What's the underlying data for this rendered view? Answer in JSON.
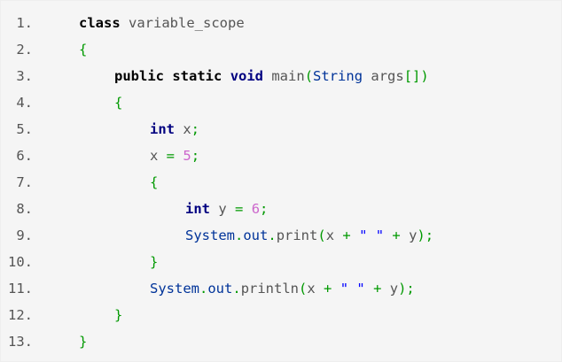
{
  "code": {
    "lines": [
      {
        "number": "1.",
        "tokens": [
          {
            "text": "class",
            "type": "kw"
          },
          {
            "text": " variable_scope",
            "type": "ident"
          }
        ],
        "indent": 0
      },
      {
        "number": "2.",
        "tokens": [
          {
            "text": "{",
            "type": "punc"
          }
        ],
        "indent": 0
      },
      {
        "number": "3.",
        "tokens": [
          {
            "text": "public",
            "type": "kw"
          },
          {
            "text": " ",
            "type": "ident"
          },
          {
            "text": "static",
            "type": "kw"
          },
          {
            "text": " ",
            "type": "ident"
          },
          {
            "text": "void",
            "type": "kw-type"
          },
          {
            "text": " main",
            "type": "ident"
          },
          {
            "text": "(",
            "type": "punc"
          },
          {
            "text": "String",
            "type": "cls"
          },
          {
            "text": " args",
            "type": "ident"
          },
          {
            "text": "[])",
            "type": "punc"
          }
        ],
        "indent": 1
      },
      {
        "number": "4.",
        "tokens": [
          {
            "text": "{",
            "type": "punc"
          }
        ],
        "indent": 1
      },
      {
        "number": "5.",
        "tokens": [
          {
            "text": "int",
            "type": "kw-type"
          },
          {
            "text": " x",
            "type": "ident"
          },
          {
            "text": ";",
            "type": "punc"
          }
        ],
        "indent": 2
      },
      {
        "number": "6.",
        "tokens": [
          {
            "text": "x ",
            "type": "ident"
          },
          {
            "text": "=",
            "type": "punc"
          },
          {
            "text": " ",
            "type": "ident"
          },
          {
            "text": "5",
            "type": "num"
          },
          {
            "text": ";",
            "type": "punc"
          }
        ],
        "indent": 2
      },
      {
        "number": "7.",
        "tokens": [
          {
            "text": "{",
            "type": "punc"
          }
        ],
        "indent": 2
      },
      {
        "number": "8.",
        "tokens": [
          {
            "text": "int",
            "type": "kw-type"
          },
          {
            "text": " y ",
            "type": "ident"
          },
          {
            "text": "=",
            "type": "punc"
          },
          {
            "text": " ",
            "type": "ident"
          },
          {
            "text": "6",
            "type": "num"
          },
          {
            "text": ";",
            "type": "punc"
          }
        ],
        "indent": 3
      },
      {
        "number": "9.",
        "tokens": [
          {
            "text": "System",
            "type": "cls"
          },
          {
            "text": ".",
            "type": "punc"
          },
          {
            "text": "out",
            "type": "cls"
          },
          {
            "text": ".",
            "type": "punc"
          },
          {
            "text": "print",
            "type": "ident"
          },
          {
            "text": "(",
            "type": "punc"
          },
          {
            "text": "x ",
            "type": "ident"
          },
          {
            "text": "+",
            "type": "punc"
          },
          {
            "text": " ",
            "type": "ident"
          },
          {
            "text": "\" \"",
            "type": "str"
          },
          {
            "text": " ",
            "type": "ident"
          },
          {
            "text": "+",
            "type": "punc"
          },
          {
            "text": " y",
            "type": "ident"
          },
          {
            "text": ");",
            "type": "punc"
          }
        ],
        "indent": 3
      },
      {
        "number": "10.",
        "tokens": [
          {
            "text": "}",
            "type": "punc"
          }
        ],
        "indent": 2
      },
      {
        "number": "11.",
        "tokens": [
          {
            "text": "System",
            "type": "cls"
          },
          {
            "text": ".",
            "type": "punc"
          },
          {
            "text": "out",
            "type": "cls"
          },
          {
            "text": ".",
            "type": "punc"
          },
          {
            "text": "println",
            "type": "ident"
          },
          {
            "text": "(",
            "type": "punc"
          },
          {
            "text": "x ",
            "type": "ident"
          },
          {
            "text": "+",
            "type": "punc"
          },
          {
            "text": " ",
            "type": "ident"
          },
          {
            "text": "\" \"",
            "type": "str"
          },
          {
            "text": " ",
            "type": "ident"
          },
          {
            "text": "+",
            "type": "punc"
          },
          {
            "text": " y",
            "type": "ident"
          },
          {
            "text": ");",
            "type": "punc"
          }
        ],
        "indent": 2
      },
      {
        "number": "12.",
        "tokens": [
          {
            "text": "}",
            "type": "punc"
          }
        ],
        "indent": 1
      },
      {
        "number": "13.",
        "tokens": [
          {
            "text": "}",
            "type": "punc"
          }
        ],
        "indent": 0
      }
    ]
  },
  "colors": {
    "background": "#f5f5f5",
    "line_number": "#555555",
    "keyword": "#000000",
    "type_keyword": "#000080",
    "punctuation": "#009900",
    "number": "#cc66cc",
    "class_name": "#003399"
  }
}
